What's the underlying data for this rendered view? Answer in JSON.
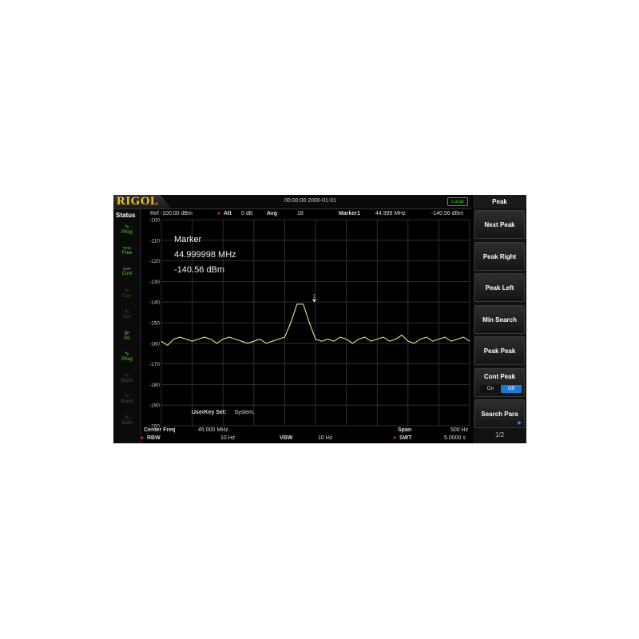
{
  "app": {
    "logo": "RIGOL",
    "datetime": "00:00:00 2000-01-01",
    "local": "Local"
  },
  "status": {
    "title": "Status",
    "items": [
      {
        "top": "",
        "label": "PAvg",
        "icon": "wave-icon",
        "state": "on"
      },
      {
        "top": "TRIG",
        "label": "Free",
        "icon": "",
        "state": "on"
      },
      {
        "top": "SWP",
        "label": "Cont",
        "icon": "",
        "state": "on"
      },
      {
        "top": "",
        "label": "Corr",
        "icon": "wave-icon",
        "state": "off"
      },
      {
        "top": "",
        "label": "Ext",
        "icon": "wave-icon",
        "state": "off"
      },
      {
        "top": "",
        "label": "PA",
        "icon": "amp-icon",
        "state": "on"
      },
      {
        "top": "",
        "label": "PAvg",
        "icon": "wave-icon",
        "state": "on"
      },
      {
        "top": "",
        "label": "Blank",
        "icon": "wave-icon",
        "state": "off"
      },
      {
        "top": "",
        "label": "Blank",
        "icon": "wave-icon",
        "state": "off"
      },
      {
        "top": "",
        "label": "Math",
        "icon": "wave-icon",
        "state": "off"
      }
    ]
  },
  "header": {
    "ref": "Ref -100.00 dBm",
    "att_label": "Att",
    "att_value": "0 dB",
    "avg_label": "Avg",
    "avg_value": "18",
    "marker": "Marker1",
    "marker_freq": "44.999 MHz",
    "marker_amp": "-140.56 dBm"
  },
  "marker_box": {
    "title": "Marker",
    "freq": "44.999998 MHz",
    "amp": "-140.56 dBm",
    "marker_label": "1"
  },
  "userkey": {
    "label": "UserKey Set:",
    "value": "System,"
  },
  "footer": {
    "center_label": "Center Freq",
    "center_value": "45.000 MHz",
    "span_label": "Span",
    "span_value": "500 Hz",
    "rbw_label": "RBW",
    "rbw_value": "10 Hz",
    "vbw_label": "VBW",
    "vbw_value": "10 Hz",
    "swt_label": "SWT",
    "swt_value": "5.0000 s"
  },
  "menu": {
    "title": "Peak",
    "keys": [
      "Next Peak",
      "Peak Right",
      "Peak Left",
      "Min Search",
      "Peak Peak",
      "Cont Peak",
      "Search Para"
    ],
    "cont_peak_on": "On",
    "cont_peak_off": "Off",
    "page": "1/2"
  },
  "colors": {
    "trace": "#e8e39a",
    "grid": "#3a3a3a",
    "toggle_active": "#1d7ad4",
    "status_on": "#5ccc3a",
    "logo": "#f4c430"
  },
  "chart_data": {
    "type": "line",
    "ylabel": "",
    "xlabel": "",
    "yticks": [
      -100,
      -110,
      -120,
      -130,
      -140,
      -150,
      -160,
      -170,
      -180,
      -190,
      -200
    ],
    "ylim": [
      -200,
      -100
    ],
    "xlim": [
      44.99975,
      45.00025
    ],
    "grid": true,
    "series": [
      {
        "x": [
          44.99975,
          44.99976,
          44.99977,
          44.99978,
          44.99979,
          44.9998,
          44.99981,
          44.99982,
          44.99983,
          44.99984,
          44.99985,
          44.99986,
          44.99987,
          44.99988,
          44.99989,
          44.9999,
          44.99991,
          44.99992,
          44.99993,
          44.99994,
          44.99995,
          44.99996,
          44.99997,
          44.99998,
          44.99999,
          45.0,
          45.00001,
          45.00002,
          45.00003,
          45.00004,
          45.00005,
          45.00006,
          45.00007,
          45.00008,
          45.00009,
          45.0001,
          45.00011,
          45.00012,
          45.00013,
          45.00014,
          45.00015,
          45.00016,
          45.00017,
          45.00018,
          45.00019,
          45.0002,
          45.00021,
          45.00022,
          45.00023,
          45.00024,
          45.00025
        ],
        "y": [
          -159,
          -161,
          -158,
          -157,
          -158,
          -159,
          -158,
          -157,
          -158,
          -160,
          -158,
          -157,
          -158,
          -159,
          -160,
          -159,
          -158,
          -160,
          -159,
          -158,
          -157,
          -150,
          -141,
          -141,
          -150,
          -158,
          -159,
          -158,
          -159,
          -157,
          -158,
          -160,
          -158,
          -157,
          -159,
          -158,
          -157,
          -159,
          -158,
          -156,
          -159,
          -160,
          -158,
          -157,
          -159,
          -158,
          -157,
          -159,
          -158,
          -157,
          -159
        ]
      }
    ],
    "marker": {
      "label": "1",
      "x": 44.999998,
      "y": -140.56
    }
  }
}
